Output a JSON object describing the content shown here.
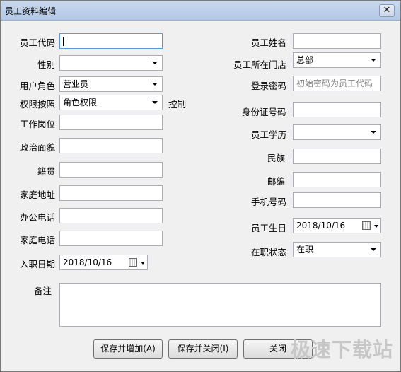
{
  "window": {
    "title": "员工资料编辑",
    "close_glyph": "✕"
  },
  "left": {
    "code_label": "员工代码",
    "code_value": "",
    "gender_label": "性别",
    "gender_value": "",
    "role_label": "用户角色",
    "role_value": "营业员",
    "perm_label": "权限按照",
    "perm_value": "角色权限",
    "perm_suffix": "控制",
    "post_label": "工作岗位",
    "political_label": "政治面貌",
    "native_label": "籍贯",
    "address_label": "家庭地址",
    "office_phone_label": "办公电话",
    "home_phone_label": "家庭电话",
    "hire_label": "入职日期",
    "hire_value": "2018/10/16",
    "memo_label": "备注"
  },
  "right": {
    "name_label": "员工姓名",
    "store_label": "员工所在门店",
    "store_value": "总部",
    "password_label": "登录密码",
    "password_placeholder": "初始密码为员工代码",
    "id_label": "身份证号码",
    "edu_label": "员工学历",
    "edu_value": "",
    "nation_label": "民族",
    "zip_label": "邮编",
    "mobile_label": "手机号码",
    "birthday_label": "员工生日",
    "birthday_value": "2018/10/16",
    "status_label": "在职状态",
    "status_value": "在职"
  },
  "buttons": {
    "save_add": "保存并增加(A)",
    "save_close": "保存并关闭(I)",
    "close": "关闭"
  },
  "watermark": "极速下载站"
}
